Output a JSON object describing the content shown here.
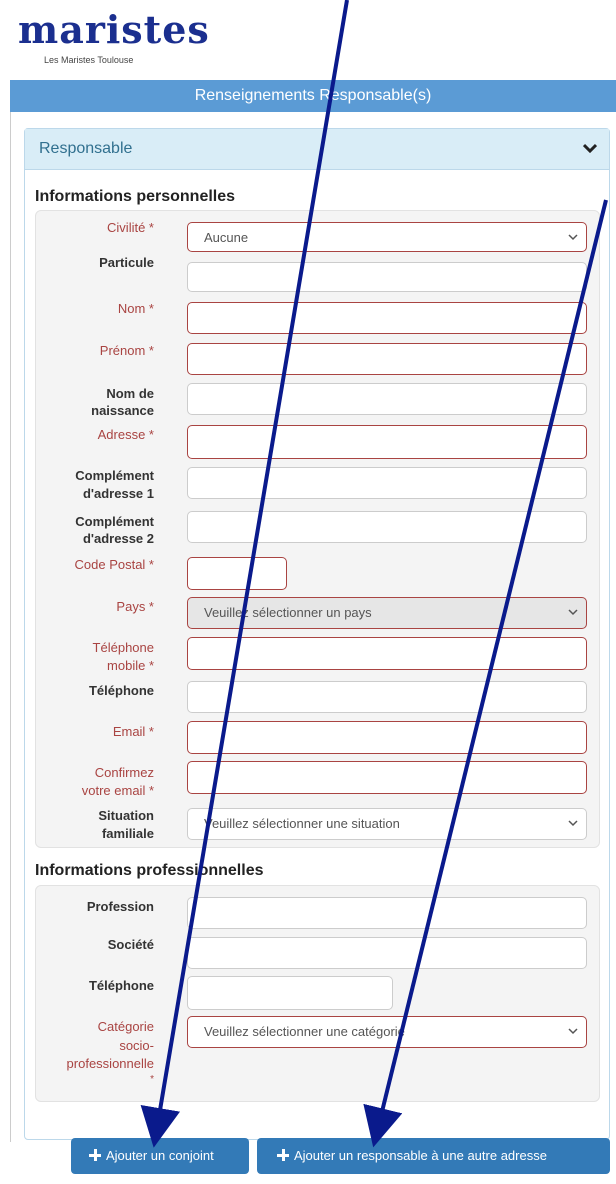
{
  "logo": {
    "wordmark": "maristes",
    "subtitle": "Les Maristes Toulouse"
  },
  "banner": {
    "title": "Renseignements Responsable(s)"
  },
  "panel": {
    "title": "Responsable"
  },
  "personal": {
    "title": "Informations personnelles",
    "civilite": {
      "label": "Civilité *",
      "value": "Aucune"
    },
    "particule": {
      "label": "Particule"
    },
    "nom": {
      "label": "Nom *"
    },
    "prenom": {
      "label": "Prénom *"
    },
    "nom_naissance": {
      "label_1": "Nom de",
      "label_2": "naissance"
    },
    "adresse": {
      "label": "Adresse *"
    },
    "complement1": {
      "label_1": "Complément",
      "label_2": "d'adresse 1"
    },
    "complement2": {
      "label_1": "Complément",
      "label_2": "d'adresse 2"
    },
    "code_postal": {
      "label": "Code Postal *"
    },
    "pays": {
      "label": "Pays *",
      "value": "Veuillez sélectionner un pays"
    },
    "tel_mobile": {
      "label_1": "Téléphone",
      "label_2": "mobile *"
    },
    "telephone": {
      "label": "Téléphone"
    },
    "email": {
      "label": "Email *"
    },
    "confirm_email": {
      "label_1": "Confirmez",
      "label_2": "votre email *"
    },
    "situation": {
      "label_1": "Situation",
      "label_2": "familiale",
      "value": "Veuillez sélectionner une situation"
    }
  },
  "professional": {
    "title": "Informations professionnelles",
    "profession": {
      "label": "Profession"
    },
    "societe": {
      "label": "Société"
    },
    "telephone": {
      "label": "Téléphone"
    },
    "categorie": {
      "label_1": "Catégorie",
      "label_2": "socio-",
      "label_3": "professionnelle",
      "label_4": "*",
      "value": "Veuillez sélectionner une catégorie"
    }
  },
  "buttons": {
    "add_spouse": "Ajouter un conjoint",
    "add_responsible": "Ajouter un responsable à une autre adresse"
  },
  "colors": {
    "brand": "#1b2f8f",
    "banner": "#5b9bd5",
    "button": "#337ab7",
    "required": "#a94442",
    "panel_head": "#d9edf7",
    "annotation_arrow": "#0a1a8c"
  },
  "icons": {
    "panel_toggle": "chevron-down-icon",
    "button": "plus-icon",
    "select": "caret-down-icon"
  }
}
